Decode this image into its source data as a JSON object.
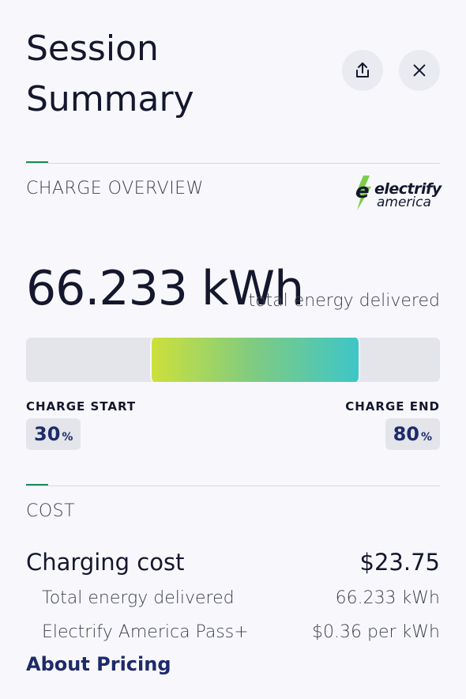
{
  "header": {
    "title_line1": "Session",
    "title_line2": "Summary"
  },
  "icons": {
    "share": "share-icon",
    "close": "close-icon"
  },
  "charge_overview": {
    "section_label": "CHARGE OVERVIEW",
    "brand": {
      "line1": "electrify",
      "line2": "america",
      "accent_color": "#7bcf4a"
    },
    "energy_value": "66.233 kWh",
    "energy_caption": "total energy delivered",
    "charge_start": {
      "label": "CHARGE START",
      "value": "30",
      "unit": "%",
      "fraction": 0.3
    },
    "charge_end": {
      "label": "CHARGE END",
      "value": "80",
      "unit": "%",
      "fraction": 0.8
    }
  },
  "cost": {
    "section_label": "COST",
    "charging_cost_label": "Charging cost",
    "charging_cost_value": "$23.75",
    "rows": [
      {
        "label": "Total energy delivered",
        "value": "66.233 kWh"
      },
      {
        "label": "Electrify America Pass+",
        "value": "$0.36 per kWh"
      }
    ],
    "about_link": "About Pricing"
  },
  "colors": {
    "accent_green": "#1f8a5b",
    "link_navy": "#1d2a6b",
    "gradient_start": "#cde03b",
    "gradient_end": "#3ec6c8"
  }
}
